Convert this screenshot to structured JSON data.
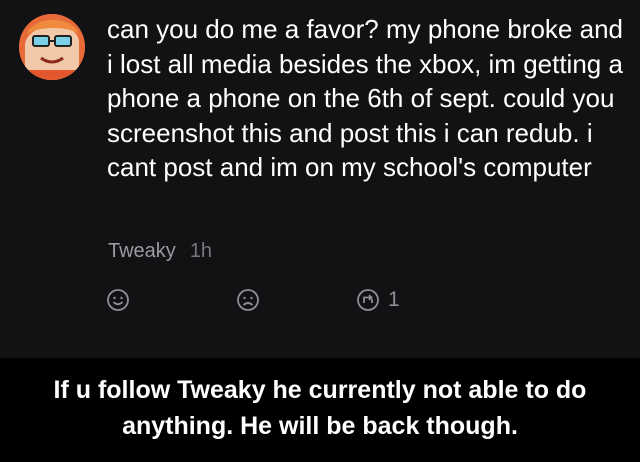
{
  "post": {
    "text": "can you do me a favor? my phone broke and i lost all media besides the xbox, im getting a phone a phone on the 6th of sept. could you screenshot this and post this i can redub. i cant post and im on my school's computer",
    "author": "Tweaky",
    "time": "1h",
    "actions": {
      "happy_icon": "smile-face-icon",
      "sad_icon": "sad-face-icon",
      "repost_icon": "repost-circle-icon",
      "repost_count": "1"
    }
  },
  "caption": {
    "line1": "If u follow Tweaky he currently not able to do",
    "line2": "anything. He will be back though."
  },
  "colors": {
    "post_background": "#121214",
    "page_background": "#000000",
    "text": "#ffffff",
    "meta": "#9b9b9f"
  }
}
